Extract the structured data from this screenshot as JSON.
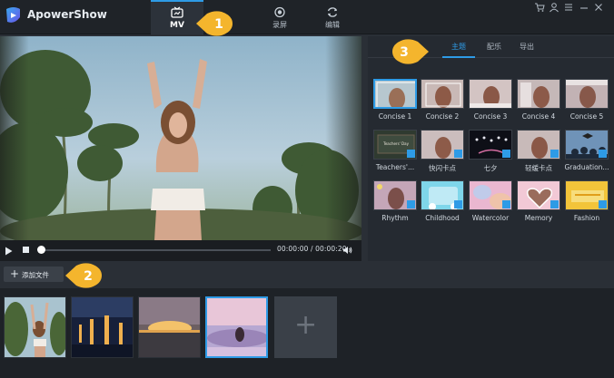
{
  "app": {
    "title": "ApowerShow"
  },
  "nav": {
    "tabs": [
      {
        "label": "MV",
        "icon": "mv-icon",
        "active": true
      },
      {
        "label": "录屏",
        "icon": "record-icon",
        "active": false
      },
      {
        "label": "编辑",
        "icon": "edit-icon",
        "active": false
      }
    ]
  },
  "window_controls": [
    "cart-icon",
    "user-icon",
    "menu-icon",
    "minimize-icon",
    "close-icon"
  ],
  "player": {
    "timecode": "00:00:00 / 00:00:20",
    "progress": 0.0
  },
  "right_panel": {
    "tabs": [
      {
        "label": "主题",
        "active": true
      },
      {
        "label": "配乐",
        "active": false
      },
      {
        "label": "导出",
        "active": false
      }
    ],
    "themes": [
      {
        "name": "Concise 1",
        "selected": true,
        "download": false
      },
      {
        "name": "Concise 2",
        "selected": false,
        "download": false
      },
      {
        "name": "Concise 3",
        "selected": false,
        "download": false
      },
      {
        "name": "Concise 4",
        "selected": false,
        "download": false
      },
      {
        "name": "Concise 5",
        "selected": false,
        "download": false
      },
      {
        "name": "Teachers'...",
        "selected": false,
        "download": true,
        "thumb_text": "Teachers' Day"
      },
      {
        "name": "快闪卡点",
        "selected": false,
        "download": true
      },
      {
        "name": "七夕",
        "selected": false,
        "download": true
      },
      {
        "name": "轻缓卡点",
        "selected": false,
        "download": true
      },
      {
        "name": "Graduation...",
        "selected": false,
        "download": true
      },
      {
        "name": "Rhythm",
        "selected": false,
        "download": true
      },
      {
        "name": "Childhood",
        "selected": false,
        "download": true
      },
      {
        "name": "Watercolor",
        "selected": false,
        "download": true
      },
      {
        "name": "Memory",
        "selected": false,
        "download": true
      },
      {
        "name": "Fashion",
        "selected": false,
        "download": true
      }
    ]
  },
  "add_file": {
    "label": "添加文件"
  },
  "callouts": [
    "1",
    "2",
    "3"
  ],
  "colors": {
    "accent": "#2e9be6",
    "callout": "#f4b52d"
  }
}
